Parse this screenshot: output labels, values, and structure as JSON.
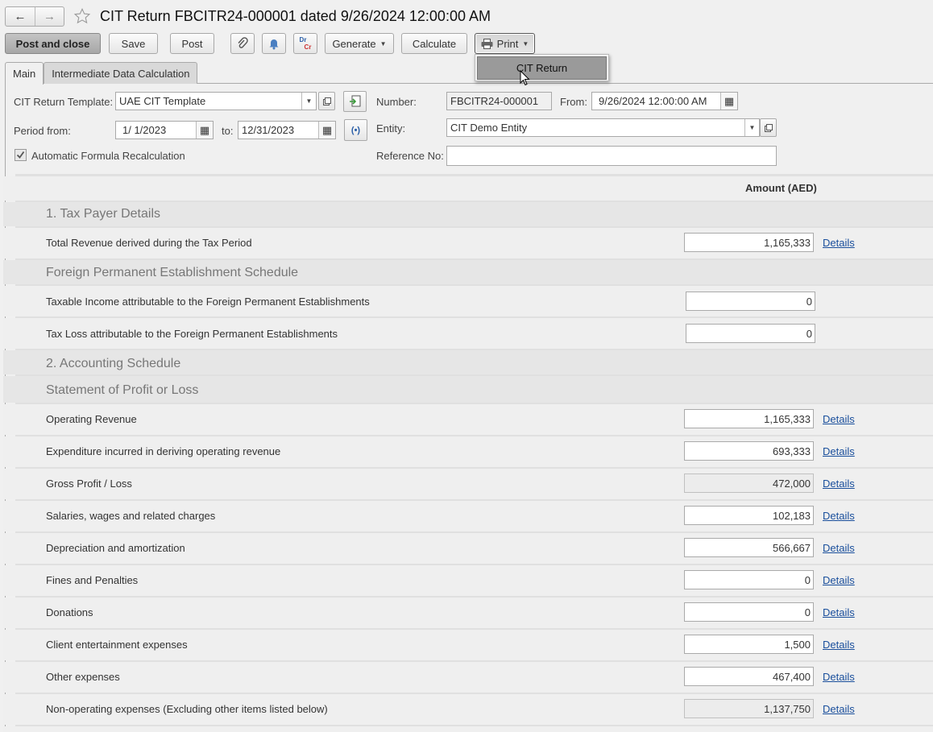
{
  "title": "CIT Return FBCITR24-000001 dated 9/26/2024 12:00:00 AM",
  "toolbar": {
    "post_and_close": "Post and close",
    "save": "Save",
    "post": "Post",
    "generate": "Generate",
    "calculate": "Calculate",
    "print": "Print",
    "dr_cr_top": "Dr",
    "dr_cr_bottom": "Cr"
  },
  "print_menu": {
    "item": "CIT Return"
  },
  "tabs": {
    "main": "Main",
    "intermediate": "Intermediate Data Calculation"
  },
  "header": {
    "template_label": "CIT Return Template:",
    "template_value": "UAE CIT Template",
    "number_label": "Number:",
    "number_value": "FBCITR24-000001",
    "from_label": "From:",
    "from_value": "9/26/2024 12:00:00 AM",
    "period_from_label": "Period from:",
    "period_from_value": "1/ 1/2023",
    "to_label": "to:",
    "to_value": "12/31/2023",
    "entity_label": "Entity:",
    "entity_value": "CIT Demo Entity",
    "auto_recalc_label": "Automatic Formula Recalculation",
    "auto_recalc_checked": true,
    "reference_label": "Reference No:",
    "reference_value": ""
  },
  "grid": {
    "amount_header": "Amount (AED)",
    "details_label": "Details",
    "sections": {
      "tax_payer": "1. Tax Payer Details",
      "foreign_pe": "Foreign Permanent Establishment Schedule",
      "accounting": "2. Accounting Schedule",
      "profit_loss": "Statement of Profit or Loss"
    },
    "rows": {
      "total_revenue": {
        "label": "Total Revenue derived during the Tax Period",
        "value": "1,165,333"
      },
      "taxable_income_fpe": {
        "label": "Taxable Income attributable to the Foreign Permanent Establishments",
        "value": "0"
      },
      "tax_loss_fpe": {
        "label": "Tax Loss attributable to the Foreign Permanent Establishments",
        "value": "0"
      },
      "operating_revenue": {
        "label": "Operating Revenue",
        "value": "1,165,333"
      },
      "expenditure": {
        "label": "Expenditure incurred in deriving operating revenue",
        "value": "693,333"
      },
      "gross_profit": {
        "label": "Gross Profit / Loss",
        "value": "472,000"
      },
      "salaries": {
        "label": "Salaries, wages and related charges",
        "value": "102,183"
      },
      "depreciation": {
        "label": "Depreciation and amortization",
        "value": "566,667"
      },
      "fines": {
        "label": "Fines and Penalties",
        "value": "0"
      },
      "donations": {
        "label": "Donations",
        "value": "0"
      },
      "entertainment": {
        "label": "Client entertainment expenses",
        "value": "1,500"
      },
      "other_expenses": {
        "label": "Other expenses",
        "value": "467,400"
      },
      "non_operating": {
        "label": "Non-operating expenses (Excluding other items listed below)",
        "value": "1,137,750"
      }
    }
  }
}
